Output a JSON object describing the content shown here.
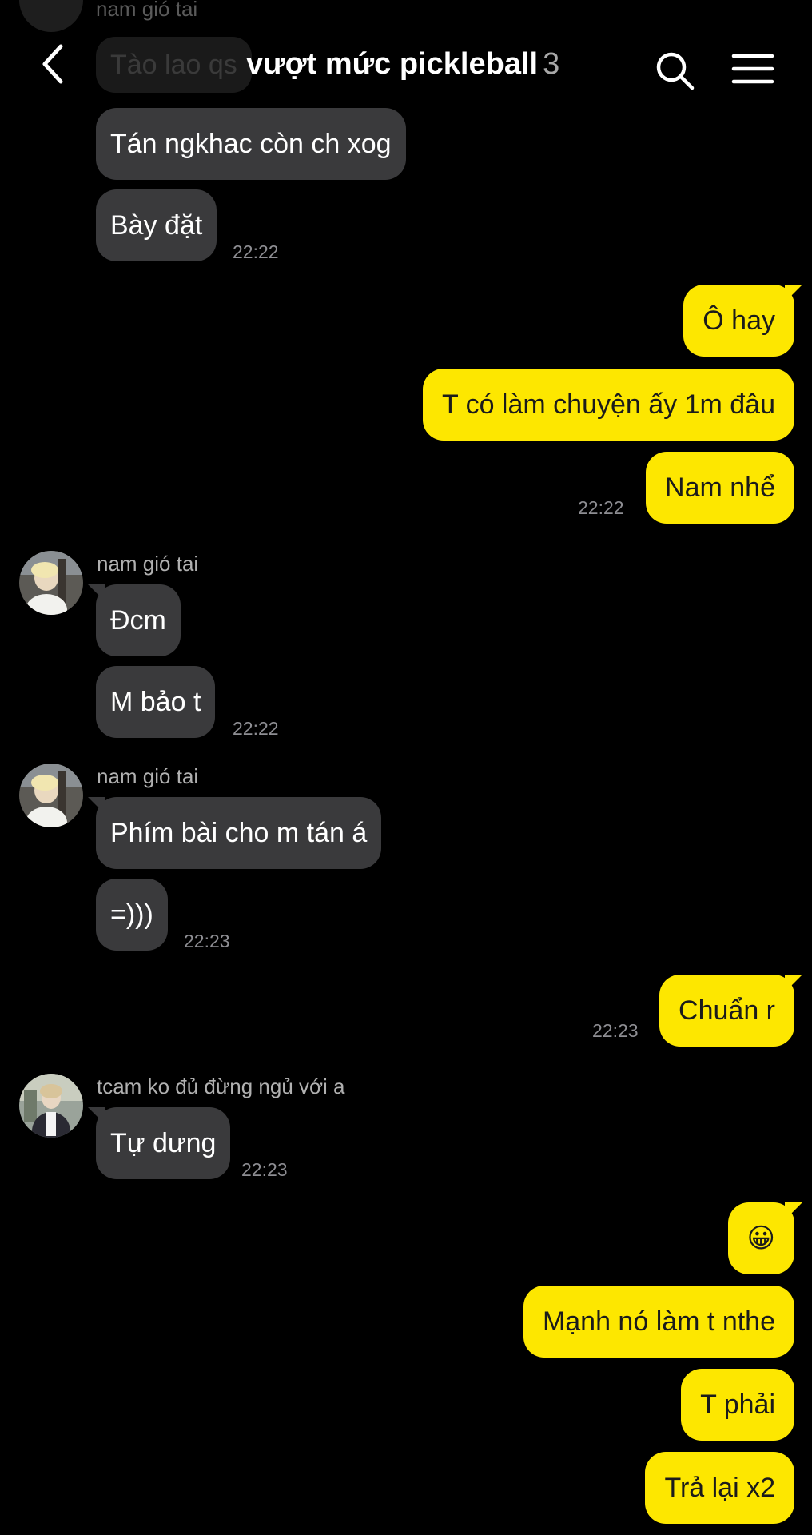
{
  "header": {
    "title": "vượt mức pickleball",
    "member_count": "3"
  },
  "ghost": {
    "sender": "nam gió tai",
    "text": "Tào lao qs"
  },
  "messages": {
    "m1": "Tán ngkhac còn ch xog",
    "m2": "Bày đặt",
    "t1": "22:22",
    "m3": "Ô hay",
    "m4": "T có làm chuyện ấy 1m đâu",
    "m5": "Nam nhể",
    "t2": "22:22",
    "s1": "nam gió tai",
    "m6": "Đcm",
    "m7": "M bảo t",
    "t3": "22:22",
    "s2": "nam gió tai",
    "m8": "Phím bài cho m tán á",
    "m9": "=)))",
    "t4": "22:23",
    "m10": "Chuẩn r",
    "t5": "22:23",
    "s3": "tcam ko đủ đừng ngủ với a",
    "m11": "Tự dưng",
    "t6": "22:23",
    "m12": "😀",
    "m13": "Mạnh nó làm t nthe",
    "m14": "T phải",
    "m15": "Trả lại x2"
  },
  "colors": {
    "background": "#000000",
    "incoming_bubble": "#3a3a3c",
    "outgoing_bubble": "#fde700",
    "timestamp": "#8e8e93"
  },
  "icons": {
    "back": "chevron-left-icon",
    "search": "search-icon",
    "menu": "hamburger-menu-icon"
  }
}
